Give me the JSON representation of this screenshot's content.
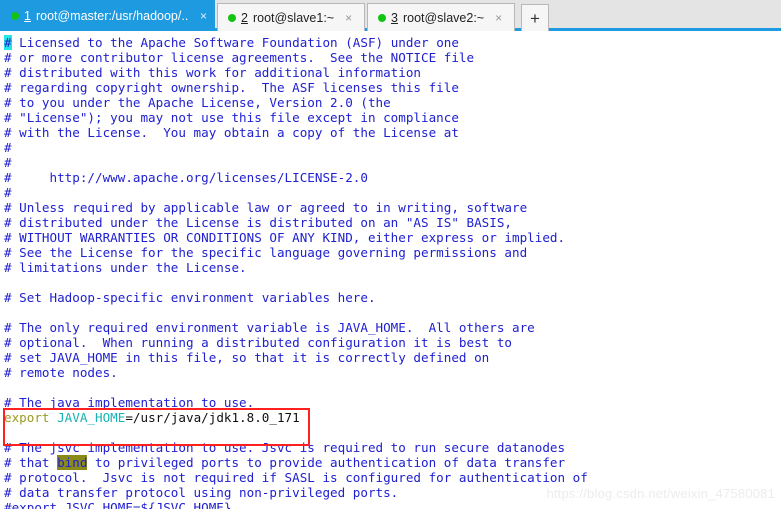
{
  "window": {
    "tabbar": {
      "accent_color": "#1e9ae0",
      "background": "#e4e4e4",
      "new_tab_label": "+",
      "close_glyph": "×",
      "tabs": [
        {
          "number": "1",
          "title": "root@master:/usr/hadoop/...",
          "status": "connected",
          "status_color": "#14c414",
          "active": true
        },
        {
          "number": "2",
          "title": "root@slave1:~",
          "status": "connected",
          "status_color": "#14c414",
          "active": false
        },
        {
          "number": "3",
          "title": "root@slave2:~",
          "status": "connected",
          "status_color": "#14c414",
          "active": false
        }
      ]
    }
  },
  "terminal": {
    "foreground": "#2020d0",
    "background": "#ffffff",
    "cursor_color": "#27e5e5",
    "search_highlight_color": "#8a8a1a",
    "lines": {
      "l01_a": "#",
      "l01_b": " Licensed to the Apache Software Foundation (ASF) under one",
      "l02": "# or more contributor license agreements.  See the NOTICE file",
      "l03": "# distributed with this work for additional information",
      "l04": "# regarding copyright ownership.  The ASF licenses this file",
      "l05": "# to you under the Apache License, Version 2.0 (the",
      "l06": "# \"License\"); you may not use this file except in compliance",
      "l07": "# with the License.  You may obtain a copy of the License at",
      "l08": "#",
      "l09": "#",
      "l10": "#     http://www.apache.org/licenses/LICENSE-2.0",
      "l11": "#",
      "l12": "# Unless required by applicable law or agreed to in writing, software",
      "l13": "# distributed under the License is distributed on an \"AS IS\" BASIS,",
      "l14": "# WITHOUT WARRANTIES OR CONDITIONS OF ANY KIND, either express or implied.",
      "l15": "# See the License for the specific language governing permissions and",
      "l16": "# limitations under the License.",
      "l17": "",
      "l18": "# Set Hadoop-specific environment variables here.",
      "l19": "",
      "l20": "# The only required environment variable is JAVA_HOME.  All others are",
      "l21": "# optional.  When running a distributed configuration it is best to",
      "l22": "# set JAVA_HOME in this file, so that it is correctly defined on",
      "l23": "# remote nodes.",
      "l24": "",
      "l25": "# The java implementation to use.",
      "l26_export": "export",
      "l26_var": " JAVA_HOME",
      "l26_val": "=/usr/java/jdk1.8.0_171",
      "l27": "",
      "l28": "# The jsvc implementation to use. Jsvc is required to run secure datanodes",
      "l29_a": "# that ",
      "l29_hl": "bind",
      "l29_b": " to privileged ports to provide authentication of data transfer",
      "l30": "# protocol.  Jsvc is not required if SASL is configured for authentication of",
      "l31": "# data transfer protocol using non-privileged ports.",
      "l32": "#export JSVC_HOME=${JSVC_HOME}"
    }
  },
  "annotation": {
    "redbox": {
      "color": "#ff2020",
      "target": "export JAVA_HOME=/usr/java/jdk1.8.0_171"
    }
  },
  "watermark": {
    "text": "https://blog.csdn.net/weixin_47580081"
  }
}
